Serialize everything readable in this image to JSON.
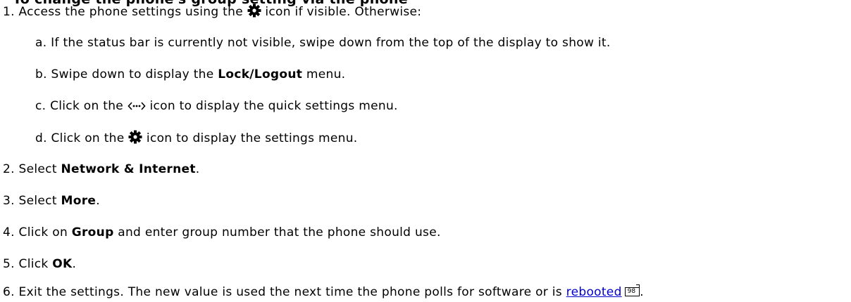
{
  "partial_heading": "To change the phone's group setting via the phone",
  "steps": [
    {
      "num": "1.",
      "text_a": "Access the phone settings using the ",
      "text_b": " icon if visible. Otherwise:"
    },
    {
      "num": "2.",
      "text_a": "Select ",
      "bold": "Network & Internet",
      "text_b": "."
    },
    {
      "num": "3.",
      "text_a": "Select ",
      "bold": "More",
      "text_b": "."
    },
    {
      "num": "4.",
      "text_a": "Click on ",
      "bold": "Group",
      "text_b": " and enter group number that the phone should use."
    },
    {
      "num": "5.",
      "text_a": "Click ",
      "bold": "OK",
      "text_b": "."
    },
    {
      "num": "6.",
      "text_a": "Exit the settings. The new value is used the next time the phone polls for software or is ",
      "link": "rebooted",
      "ref": "98",
      "text_b": "."
    }
  ],
  "substeps": [
    {
      "letter": "a.",
      "text": "If the status bar is currently not visible, swipe down from the top of the display to show it."
    },
    {
      "letter": "b.",
      "text_a": "Swipe down to display the ",
      "bold": "Lock/Logout",
      "text_b": " menu."
    },
    {
      "letter": "c.",
      "text_a": "Click on the ",
      "text_b": " icon to display the quick settings menu."
    },
    {
      "letter": "d.",
      "text_a": "Click on the ",
      "text_b": " icon to display the settings menu."
    }
  ],
  "icons": {
    "settings": "gear-icon",
    "quick_settings": "quick-settings-icon"
  }
}
